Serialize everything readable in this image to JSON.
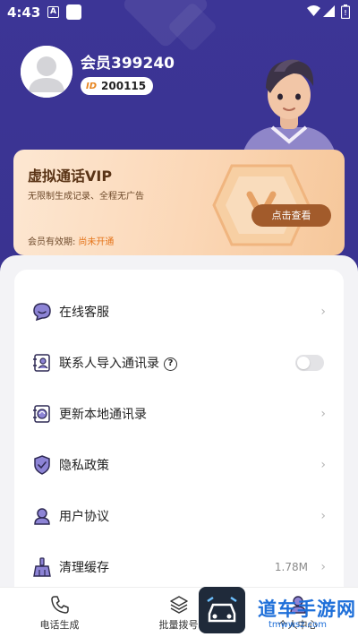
{
  "status_bar": {
    "time": "4:43",
    "notif_icon_letter": "A"
  },
  "profile": {
    "username": "会员399240",
    "id_tag": "ID",
    "id_number": "200115"
  },
  "vip_card": {
    "title": "虚拟通话VIP",
    "description": "无限制生成记录、全程无广告",
    "validity_label": "会员有效期:",
    "validity_status": "尚未开通",
    "view_button": "点击查看"
  },
  "menu": {
    "items": [
      {
        "label": "在线客服",
        "icon": "chat-bubble-icon",
        "arrow": "›"
      },
      {
        "label": "联系人导入通讯录",
        "icon": "contact-book-icon",
        "help": "?",
        "toggle_on": false
      },
      {
        "label": "更新本地通讯录",
        "icon": "refresh-book-icon",
        "arrow": "›"
      },
      {
        "label": "隐私政策",
        "icon": "shield-check-icon",
        "arrow": "›"
      },
      {
        "label": "用户协议",
        "icon": "user-icon",
        "arrow": "›"
      },
      {
        "label": "清理缓存",
        "icon": "broom-icon",
        "value": "1.78M",
        "arrow": "›"
      }
    ]
  },
  "bottom_nav": {
    "items": [
      {
        "label": "电话生成",
        "icon": "phone-icon"
      },
      {
        "label": "批量拨号",
        "icon": "layers-icon"
      },
      {
        "label": "个人中心",
        "icon": "user-icon"
      }
    ]
  },
  "watermark": {
    "text": "道车手游网",
    "url": "tmwwsz.com"
  },
  "colors": {
    "header_bg": "#3b3493",
    "vip_accent": "#a25b2b",
    "menu_icon": "#4a3fa8",
    "watermark": "#1e6fd9"
  }
}
